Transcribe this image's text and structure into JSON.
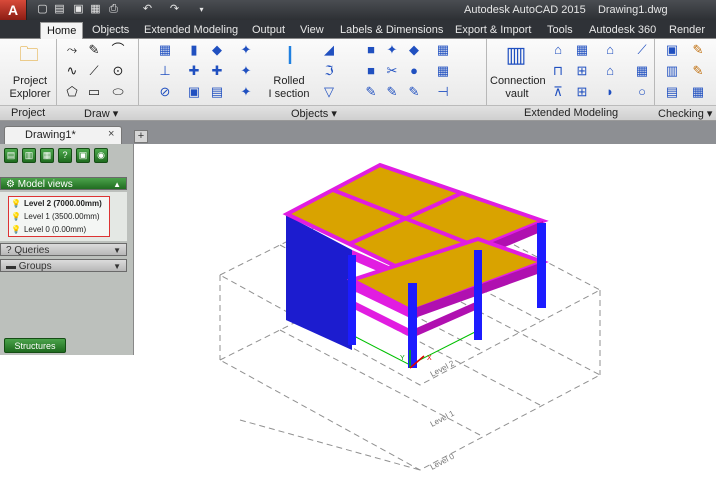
{
  "titlebar": {
    "app_name": "Autodesk AutoCAD 2015",
    "file_name": "Drawing1.dwg",
    "app_button": "A"
  },
  "quick_access": [
    "new-icon",
    "open-icon",
    "save-icon",
    "saveas-icon",
    "print-icon",
    "undo-icon",
    "redo-icon",
    "dropdown-icon"
  ],
  "ribbon_tabs": [
    "Home",
    "Objects",
    "Extended Modeling",
    "Output",
    "View",
    "Labels & Dimensions",
    "Export & Import",
    "Tools",
    "Autodesk 360",
    "Render"
  ],
  "active_tab": "Home",
  "panels": {
    "project": {
      "label": "Project",
      "button_label_1": "Project",
      "button_label_2": "Explorer"
    },
    "draw": {
      "label": "Draw"
    },
    "objects": {
      "label": "Objects",
      "rolled_label_1": "Rolled",
      "rolled_label_2": "I section"
    },
    "extended": {
      "label": "Extended Modeling",
      "conn_label_1": "Connection",
      "conn_label_2": "vault"
    },
    "checking": {
      "label": "Checking"
    }
  },
  "document_tab": {
    "label": "Drawing1*",
    "close": "×",
    "new": "+"
  },
  "palette": {
    "model_views": "Model views",
    "levels": [
      "Level 2 (7000.00mm)",
      "Level 1 (3500.00mm)",
      "Level 0 (0.00mm)"
    ],
    "queries": "Queries",
    "groups": "Groups",
    "structures_tab": "Structures"
  },
  "viewport": {
    "level_labels": [
      "Level 2",
      "Level 1",
      "Level 0"
    ],
    "axis_labels": {
      "y": "Y",
      "x": "X"
    }
  },
  "colors": {
    "slab": "#d9a300",
    "beam": "#e11de1",
    "column": "#1c1cff",
    "grid": "#909090",
    "axis_x": "#e00000",
    "axis_y": "#00b000"
  }
}
